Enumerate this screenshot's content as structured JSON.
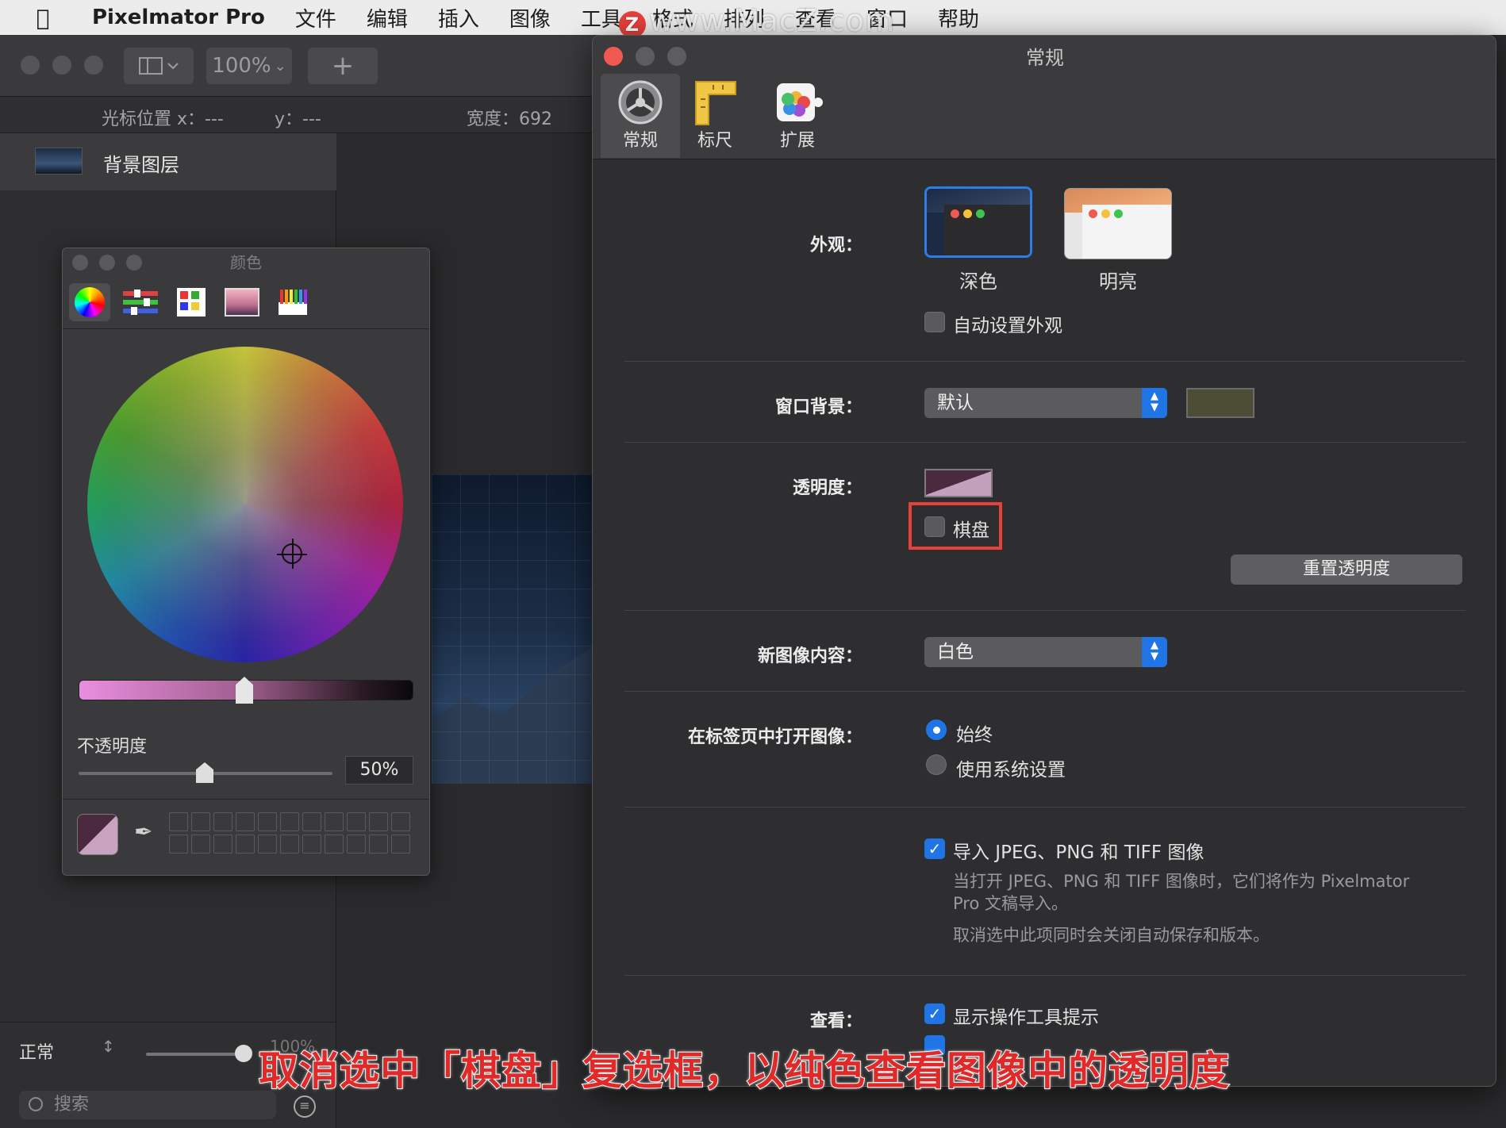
{
  "menubar": {
    "app_name": "Pixelmator Pro",
    "items": [
      "文件",
      "编辑",
      "插入",
      "图像",
      "工具",
      "格式",
      "排列",
      "查看",
      "窗口",
      "帮助"
    ],
    "watermark": "www.MacZ.com"
  },
  "main_window": {
    "zoom": "100%",
    "cursor_x_label": "光标位置 x：---",
    "cursor_y_label": "y：---",
    "width_label": "宽度：692",
    "layer_name": "背景图层",
    "blend_mode": "正常",
    "layer_opacity": "100%",
    "search_placeholder": "搜索"
  },
  "color_panel": {
    "title": "颜色",
    "opacity_label": "不透明度",
    "opacity_value": "50%",
    "swatch_color": "#4b2a40"
  },
  "prefs": {
    "title": "常规",
    "tabs": [
      {
        "label": "常规",
        "icon": "gear-icon"
      },
      {
        "label": "标尺",
        "icon": "ruler-icon"
      },
      {
        "label": "扩展",
        "icon": "extensions-icon"
      }
    ],
    "appearance": {
      "label": "外观：",
      "dark_label": "深色",
      "light_label": "明亮",
      "auto_label": "自动设置外观"
    },
    "window_bg": {
      "label": "窗口背景：",
      "value": "默认",
      "color": "#4d4d36"
    },
    "transparency": {
      "label": "透明度：",
      "checker_label": "棋盘",
      "reset_button": "重置透明度"
    },
    "new_image": {
      "label": "新图像内容：",
      "value": "白色"
    },
    "open_in_tabs": {
      "label": "在标签页中打开图像：",
      "option_always": "始终",
      "option_system": "使用系统设置"
    },
    "import": {
      "label": "导入 JPEG、PNG 和 TIFF 图像",
      "desc1_line1": "当打开 JPEG、PNG 和 TIFF 图像时，它们将作为 Pixelmator",
      "desc1_line2": "Pro 文稿导入。",
      "desc2": "取消选中此项同时会关闭自动保存和版本。"
    },
    "view": {
      "label": "查看：",
      "show_tooltips": "显示操作工具提示"
    }
  },
  "caption": "取消选中「棋盘」复选框，以纯色查看图像中的透明度"
}
